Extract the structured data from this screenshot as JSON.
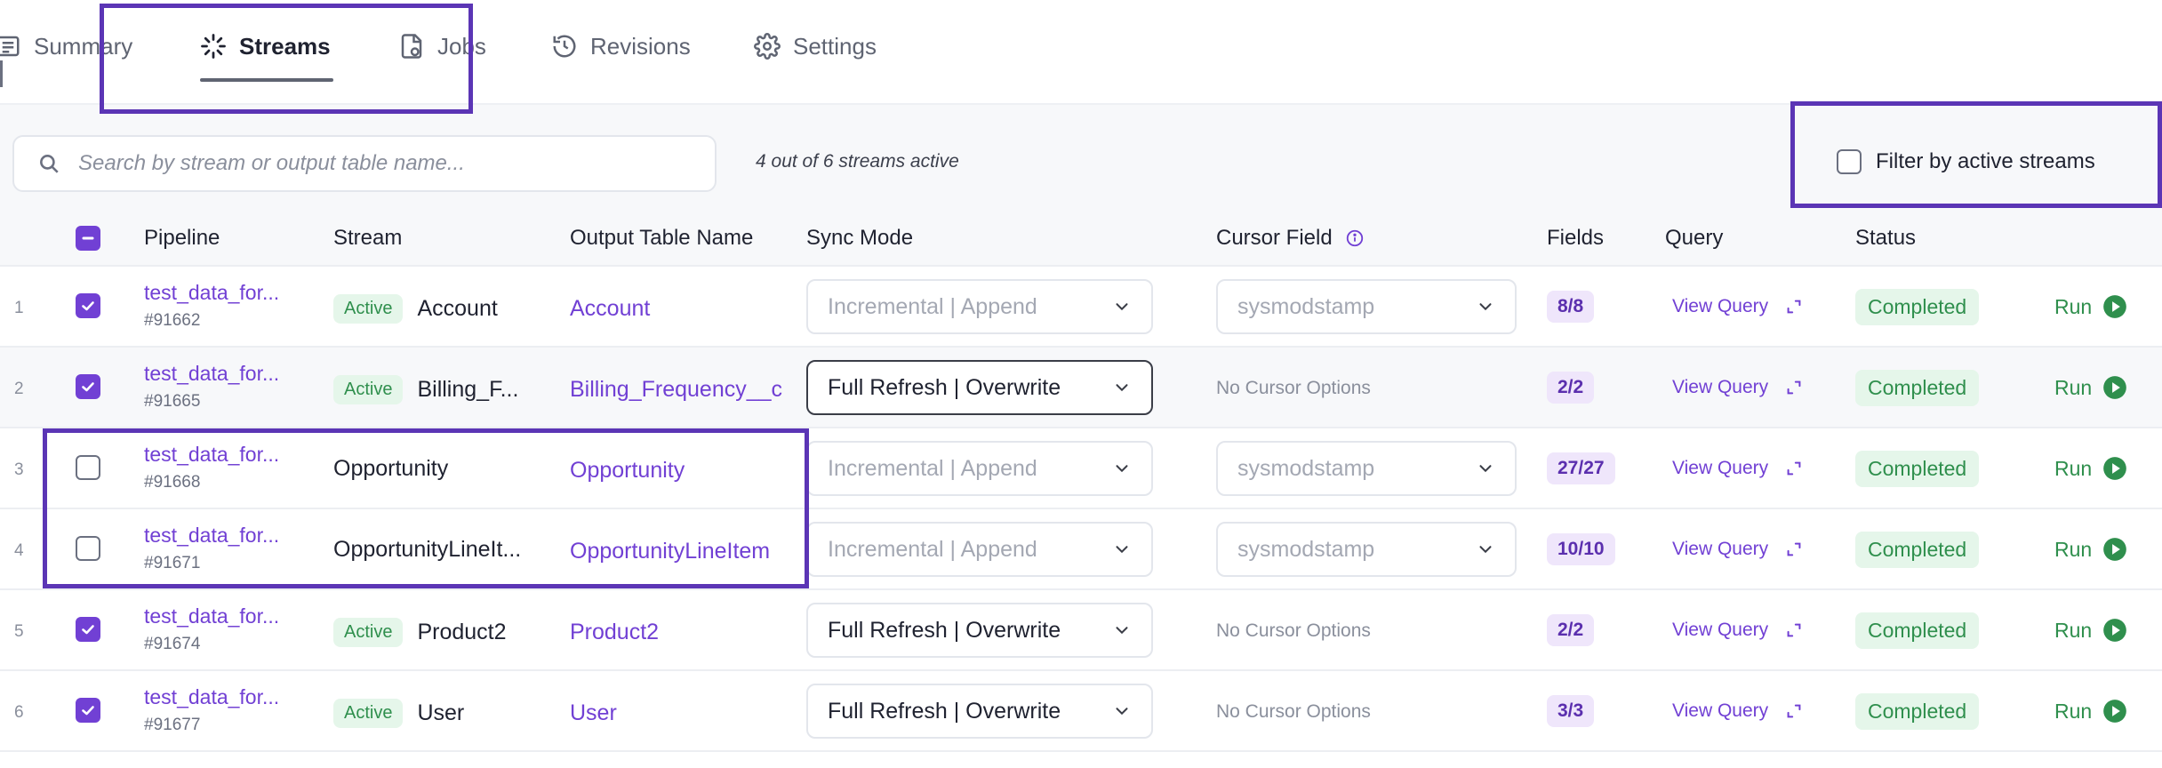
{
  "tabs": [
    {
      "label": "Summary",
      "icon": "list-icon"
    },
    {
      "label": "Streams",
      "icon": "sparkle-icon"
    },
    {
      "label": "Jobs",
      "icon": "jobs-file-icon"
    },
    {
      "label": "Revisions",
      "icon": "history-icon"
    },
    {
      "label": "Settings",
      "icon": "gear-icon"
    }
  ],
  "active_tab": "Streams",
  "search": {
    "placeholder": "Search by stream or output table name...",
    "value": ""
  },
  "active_count": "4 out of 6 streams active",
  "filter": {
    "label": "Filter by active streams",
    "checked": false
  },
  "columns": {
    "pipeline": "Pipeline",
    "stream": "Stream",
    "output_table": "Output Table Name",
    "sync_mode": "Sync Mode",
    "cursor_field": "Cursor Field",
    "fields": "Fields",
    "query": "Query",
    "status": "Status"
  },
  "rows": [
    {
      "index": "1",
      "selected": true,
      "pipeline": "test_data_for...",
      "pipeline_id": "#91662",
      "active_badge": "Active",
      "stream": "Account",
      "output_table": "Account",
      "sync_mode": "Incremental | Append",
      "sync_enabled": false,
      "cursor": "sysmodstamp",
      "has_cursor": true,
      "fields": "8/8",
      "query": "View Query",
      "status": "Completed",
      "run": "Run"
    },
    {
      "index": "2",
      "selected": true,
      "pipeline": "test_data_for...",
      "pipeline_id": "#91665",
      "active_badge": "Active",
      "stream": "Billing_F...",
      "output_table": "Billing_Frequency__c",
      "sync_mode": "Full Refresh | Overwrite",
      "sync_enabled": true,
      "cursor": "No Cursor Options",
      "has_cursor": false,
      "fields": "2/2",
      "query": "View Query",
      "status": "Completed",
      "run": "Run"
    },
    {
      "index": "3",
      "selected": false,
      "pipeline": "test_data_for...",
      "pipeline_id": "#91668",
      "active_badge": "",
      "stream": "Opportunity",
      "output_table": "Opportunity",
      "sync_mode": "Incremental | Append",
      "sync_enabled": false,
      "cursor": "sysmodstamp",
      "has_cursor": true,
      "fields": "27/27",
      "query": "View Query",
      "status": "Completed",
      "run": "Run"
    },
    {
      "index": "4",
      "selected": false,
      "pipeline": "test_data_for...",
      "pipeline_id": "#91671",
      "active_badge": "",
      "stream": "OpportunityLineIt...",
      "output_table": "OpportunityLineItem",
      "sync_mode": "Incremental | Append",
      "sync_enabled": false,
      "cursor": "sysmodstamp",
      "has_cursor": true,
      "fields": "10/10",
      "query": "View Query",
      "status": "Completed",
      "run": "Run"
    },
    {
      "index": "5",
      "selected": true,
      "pipeline": "test_data_for...",
      "pipeline_id": "#91674",
      "active_badge": "Active",
      "stream": "Product2",
      "output_table": "Product2",
      "sync_mode": "Full Refresh | Overwrite",
      "sync_enabled": false,
      "cursor": "No Cursor Options",
      "has_cursor": false,
      "fields": "2/2",
      "query": "View Query",
      "status": "Completed",
      "run": "Run"
    },
    {
      "index": "6",
      "selected": true,
      "pipeline": "test_data_for...",
      "pipeline_id": "#91677",
      "active_badge": "Active",
      "stream": "User",
      "output_table": "User",
      "sync_mode": "Full Refresh | Overwrite",
      "sync_enabled": false,
      "cursor": "No Cursor Options",
      "has_cursor": false,
      "fields": "3/3",
      "query": "View Query",
      "status": "Completed",
      "run": "Run"
    }
  ],
  "colors": {
    "accent": "#7140d4",
    "success": "#2f8f4d",
    "highlight": "#5b35b5"
  }
}
